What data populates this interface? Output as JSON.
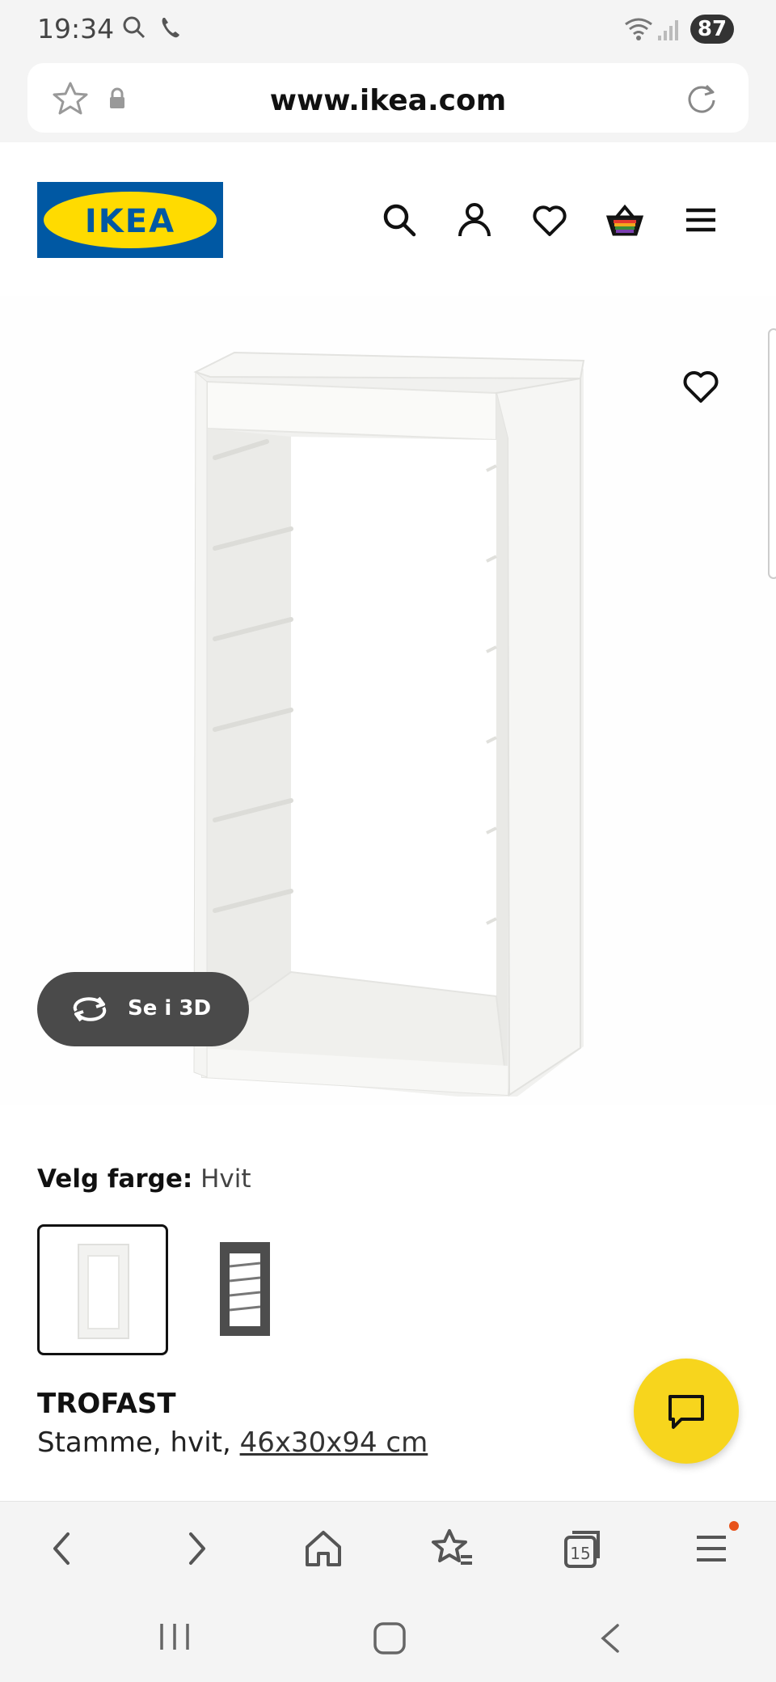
{
  "status_bar": {
    "time": "19:34",
    "battery": "87",
    "icons": [
      "search-icon",
      "phone-icon",
      "wifi-icon",
      "signal-icon"
    ]
  },
  "browser": {
    "url": "www.ikea.com",
    "left_icons": [
      "star-icon",
      "lock-icon"
    ],
    "right_icon": "reload-icon"
  },
  "header": {
    "logo_text": "IKEA",
    "icons": [
      "search-icon",
      "user-icon",
      "heart-icon",
      "cart-icon",
      "menu-icon"
    ]
  },
  "product_image": {
    "see_3d_label": "Se i 3D",
    "wishlist_icon": "heart-icon"
  },
  "color_selector": {
    "label": "Velg farge:",
    "selected_value": "Hvit",
    "swatches": [
      {
        "name": "white",
        "color": "#f2f2f2",
        "selected": true
      },
      {
        "name": "gray",
        "color": "#4d4d4d",
        "selected": false
      }
    ]
  },
  "product": {
    "name": "TROFAST",
    "description": "Stamme, hvit,",
    "dimensions": "46x30x94 cm"
  },
  "chat": {
    "icon": "chat-icon"
  },
  "toolbar": {
    "items": [
      "back-icon",
      "forward-icon",
      "home-icon",
      "bookmarks-icon",
      "tabs-icon",
      "menu-icon"
    ],
    "tabs_count": "15"
  },
  "colors": {
    "ikea_blue": "#0058a3",
    "ikea_yellow": "#ffdb00",
    "chat_yellow": "#f7d51d",
    "notification": "#e8531b"
  }
}
